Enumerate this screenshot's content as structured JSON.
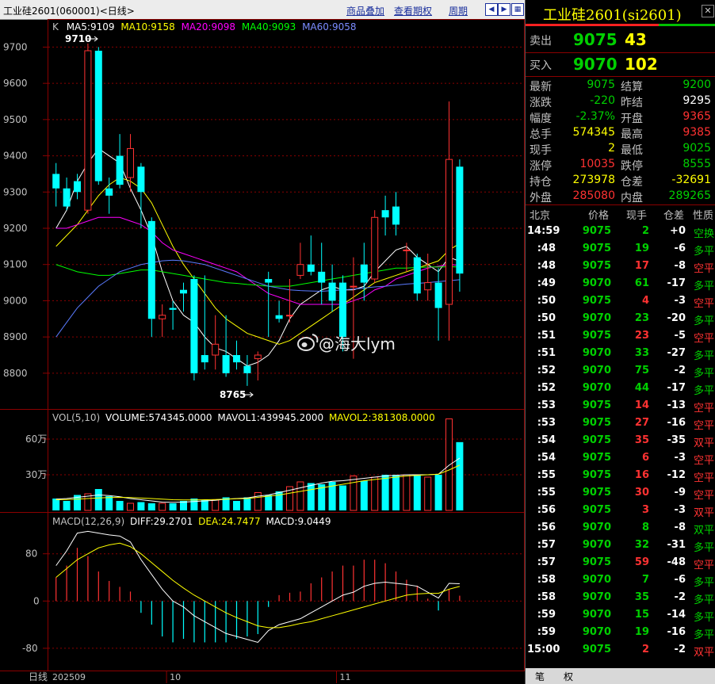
{
  "topbar": {
    "title": "工业硅2601(060001)<日线>",
    "links": [
      "商品叠加",
      "查看期权",
      "周期"
    ],
    "nav_icons": [
      "left-arrow-icon",
      "right-arrow-icon",
      "grid-icon"
    ]
  },
  "kline": {
    "indicator_label": "K",
    "ma": [
      {
        "label": "MA5:9109",
        "color": "#ffffff"
      },
      {
        "label": "MA10:9158",
        "color": "#ffff00"
      },
      {
        "label": "MA20:9098",
        "color": "#ff00ff"
      },
      {
        "label": "MA40:9093",
        "color": "#00ff00"
      },
      {
        "label": "MA60:9058",
        "color": "#5a7bff"
      }
    ],
    "high_label": "9710",
    "low_label": "8765",
    "y_ticks": [
      "9700",
      "9600",
      "9500",
      "9400",
      "9300",
      "9200",
      "9100",
      "9000",
      "8900",
      "8800"
    ],
    "ylim": [
      8710,
      9760
    ]
  },
  "volume_panel": {
    "legend": [
      {
        "label": "VOL(5,10)",
        "color": "#c0c0c0"
      },
      {
        "label": "VOLUME:574345.0000",
        "color": "#ffffff"
      },
      {
        "label": "MAVOL1:439945.2000",
        "color": "#ffffff"
      },
      {
        "label": "MAVOL2:381308.0000",
        "color": "#ffff00"
      }
    ],
    "y_ticks": [
      "60万",
      "30万"
    ],
    "ylim": [
      0,
      800000
    ]
  },
  "macd_panel": {
    "legend": [
      {
        "label": "MACD(12,26,9)",
        "color": "#c0c0c0"
      },
      {
        "label": "DIFF:29.2701",
        "color": "#ffffff"
      },
      {
        "label": "DEA:24.7477",
        "color": "#ffff00"
      },
      {
        "label": "MACD:9.0449",
        "color": "#ffffff"
      }
    ],
    "y_ticks": [
      "80",
      "0",
      "-80"
    ],
    "ylim": [
      -115,
      140
    ]
  },
  "x_axis": {
    "label": "日线",
    "ticks": [
      "202509",
      "10",
      "11"
    ]
  },
  "watermark": "@海大lym",
  "chart_data": {
    "type": "candlestick",
    "candles": [
      [
        9350,
        9380,
        9260,
        9310
      ],
      [
        9310,
        9340,
        9250,
        9260
      ],
      [
        9330,
        9350,
        9280,
        9300
      ],
      [
        9250,
        9710,
        9240,
        9690
      ],
      [
        9690,
        9700,
        9320,
        9330
      ],
      [
        9310,
        9340,
        9240,
        9290
      ],
      [
        9400,
        9460,
        9310,
        9320
      ],
      [
        9340,
        9460,
        9300,
        9420
      ],
      [
        9370,
        9380,
        9200,
        9300
      ],
      [
        9220,
        9230,
        8900,
        8950
      ],
      [
        8950,
        8990,
        8900,
        8960
      ],
      [
        8980,
        9000,
        8920,
        8975
      ],
      [
        9030,
        9050,
        8970,
        9020
      ],
      [
        9060,
        9070,
        8780,
        8800
      ],
      [
        8850,
        9070,
        8810,
        8830
      ],
      [
        8850,
        8960,
        8810,
        8880
      ],
      [
        8850,
        8960,
        8790,
        8800
      ],
      [
        8850,
        8890,
        8810,
        8830
      ],
      [
        8820,
        8850,
        8765,
        8800
      ],
      [
        8840,
        8860,
        8780,
        8850
      ],
      [
        9060,
        9080,
        8900,
        9050
      ],
      [
        8960,
        9000,
        8940,
        8950
      ],
      [
        8960,
        9060,
        8940,
        8960
      ],
      [
        9070,
        9160,
        9060,
        9100
      ],
      [
        9100,
        9180,
        9070,
        9080
      ],
      [
        9080,
        9160,
        8990,
        9050
      ],
      [
        9050,
        9100,
        8970,
        9000
      ],
      [
        9050,
        9070,
        8860,
        8900
      ],
      [
        9040,
        9120,
        8840,
        9040
      ],
      [
        9100,
        9160,
        9000,
        9050
      ],
      [
        9060,
        9250,
        9050,
        9230
      ],
      [
        9250,
        9290,
        9180,
        9230
      ],
      [
        9260,
        9300,
        9180,
        9210
      ],
      [
        9140,
        9160,
        9080,
        9140
      ],
      [
        9120,
        9130,
        9000,
        9020
      ],
      [
        9030,
        9130,
        9000,
        9050
      ],
      [
        9050,
        9090,
        8890,
        8980
      ],
      [
        8990,
        9550,
        8890,
        9390
      ],
      [
        9370,
        9390,
        9025,
        9075
      ]
    ],
    "ma5": [
      9200,
      9250,
      9330,
      9380,
      9420,
      9400,
      9380,
      9310,
      9250,
      9180,
      9080,
      9000,
      8960,
      8940,
      8900,
      8870,
      8860,
      8840,
      8820,
      8830,
      8850,
      8890,
      8950,
      8990,
      9010,
      9030,
      9040,
      9030,
      9030,
      9040,
      9080,
      9110,
      9140,
      9150,
      9120,
      9100,
      9080,
      9120,
      9109
    ],
    "ma10": [
      9150,
      9180,
      9210,
      9250,
      9290,
      9320,
      9340,
      9330,
      9310,
      9270,
      9210,
      9150,
      9100,
      9060,
      9020,
      8980,
      8950,
      8930,
      8910,
      8900,
      8890,
      8880,
      8890,
      8910,
      8930,
      8950,
      8970,
      8990,
      9010,
      9030,
      9050,
      9060,
      9070,
      9080,
      9090,
      9100,
      9110,
      9140,
      9158
    ],
    "ma20": [
      9200,
      9200,
      9210,
      9220,
      9230,
      9230,
      9230,
      9220,
      9210,
      9190,
      9160,
      9140,
      9130,
      9120,
      9110,
      9100,
      9090,
      9080,
      9060,
      9040,
      9020,
      9010,
      9000,
      8990,
      8990,
      8990,
      8990,
      8990,
      9000,
      9010,
      9030,
      9040,
      9060,
      9070,
      9080,
      9090,
      9095,
      9100,
      9098
    ],
    "ma40": [
      9100,
      9090,
      9080,
      9075,
      9070,
      9070,
      9075,
      9080,
      9085,
      9085,
      9080,
      9075,
      9070,
      9065,
      9060,
      9055,
      9050,
      9048,
      9045,
      9043,
      9040,
      9040,
      9040,
      9045,
      9050,
      9055,
      9060,
      9065,
      9070,
      9075,
      9080,
      9085,
      9090,
      9090,
      9092,
      9093,
      9093,
      9094,
      9093
    ],
    "ma60": [
      8900,
      8940,
      8980,
      9010,
      9040,
      9060,
      9080,
      9090,
      9100,
      9105,
      9110,
      9112,
      9110,
      9105,
      9100,
      9090,
      9080,
      9070,
      9060,
      9050,
      9040,
      9035,
      9030,
      9028,
      9027,
      9026,
      9028,
      9030,
      9032,
      9035,
      9038,
      9040,
      9043,
      9046,
      9048,
      9050,
      9053,
      9055,
      9058
    ],
    "volume": [
      100000,
      80000,
      130000,
      140000,
      180000,
      120000,
      80000,
      60000,
      70000,
      60000,
      60000,
      60000,
      80000,
      100000,
      90000,
      90000,
      110000,
      80000,
      110000,
      150000,
      130000,
      160000,
      200000,
      240000,
      230000,
      220000,
      240000,
      210000,
      290000,
      250000,
      280000,
      300000,
      300000,
      300000,
      300000,
      280000,
      300000,
      770000,
      574345
    ],
    "mavol1": [
      95000,
      100000,
      110000,
      120000,
      130000,
      125000,
      115000,
      100000,
      90000,
      80000,
      70000,
      68000,
      70000,
      75000,
      80000,
      85000,
      95000,
      100000,
      105000,
      120000,
      130000,
      150000,
      170000,
      190000,
      210000,
      230000,
      245000,
      250000,
      260000,
      270000,
      280000,
      290000,
      295000,
      300000,
      300000,
      300000,
      305000,
      380000,
      439945
    ],
    "mavol2": [
      90000,
      92000,
      95000,
      100000,
      105000,
      108000,
      110000,
      108000,
      104000,
      100000,
      95000,
      90000,
      88000,
      88000,
      90000,
      92000,
      95000,
      98000,
      100000,
      110000,
      120000,
      130000,
      145000,
      160000,
      175000,
      190000,
      205000,
      220000,
      235000,
      250000,
      260000,
      270000,
      280000,
      290000,
      295000,
      300000,
      305000,
      340000,
      381308
    ],
    "diff": [
      60,
      85,
      115,
      118,
      115,
      112,
      110,
      100,
      70,
      45,
      20,
      0,
      -10,
      -25,
      -35,
      -45,
      -55,
      -60,
      -65,
      -70,
      -50,
      -40,
      -35,
      -30,
      -20,
      -10,
      0,
      10,
      15,
      25,
      30,
      32,
      30,
      28,
      25,
      15,
      5,
      30,
      29.27
    ],
    "dea": [
      40,
      55,
      70,
      80,
      90,
      95,
      98,
      92,
      80,
      65,
      50,
      35,
      22,
      10,
      0,
      -10,
      -20,
      -28,
      -35,
      -42,
      -45,
      -45,
      -42,
      -38,
      -35,
      -30,
      -25,
      -20,
      -15,
      -10,
      -5,
      0,
      5,
      10,
      12,
      13,
      13,
      20,
      24.75
    ],
    "macd": [
      40,
      60,
      90,
      76,
      50,
      34,
      24,
      16,
      -20,
      -40,
      -60,
      -70,
      -64,
      -70,
      -70,
      -70,
      -70,
      -64,
      -60,
      -56,
      -10,
      10,
      14,
      16,
      30,
      40,
      50,
      60,
      60,
      70,
      70,
      64,
      50,
      36,
      26,
      4,
      -16,
      20,
      9.04
    ]
  },
  "right_panel": {
    "title": "工业硅2601(si2601)",
    "ask": {
      "label": "卖出",
      "price": "9075",
      "volume": "43"
    },
    "bid": {
      "label": "买入",
      "price": "9070",
      "volume": "102"
    },
    "quote": [
      [
        {
          "label": "最新",
          "value": "9075",
          "color": "#00d000"
        },
        {
          "label": "结算",
          "value": "9200",
          "color": "#00d000"
        }
      ],
      [
        {
          "label": "涨跌",
          "value": "-220",
          "color": "#00d000"
        },
        {
          "label": "昨结",
          "value": "9295",
          "color": "#ffffff"
        }
      ],
      [
        {
          "label": "幅度",
          "value": "-2.37%",
          "color": "#00d000"
        },
        {
          "label": "开盘",
          "value": "9365",
          "color": "#ff3232"
        }
      ],
      [
        {
          "label": "总手",
          "value": "574345",
          "color": "#ffff00"
        },
        {
          "label": "最高",
          "value": "9385",
          "color": "#ff3232"
        }
      ],
      [
        {
          "label": "现手",
          "value": "2",
          "color": "#ffff00"
        },
        {
          "label": "最低",
          "value": "9025",
          "color": "#00d000"
        }
      ],
      [
        {
          "label": "涨停",
          "value": "10035",
          "color": "#ff3232"
        },
        {
          "label": "跌停",
          "value": "8555",
          "color": "#00d000"
        }
      ],
      [
        {
          "label": "持仓",
          "value": "273978",
          "color": "#ffff00"
        },
        {
          "label": "仓差",
          "value": "-32691",
          "color": "#ffff00"
        }
      ],
      [
        {
          "label": "外盘",
          "value": "285080",
          "color": "#ff3232"
        },
        {
          "label": "内盘",
          "value": "289265",
          "color": "#00d000"
        }
      ]
    ],
    "ticks_header": [
      "北京",
      "价格",
      "现手",
      "仓差",
      "性质"
    ],
    "ticks": [
      {
        "time": "14:59",
        "price": "9075",
        "vol": "2",
        "oi": "+0",
        "nature": "空换",
        "vcolor": "#00d000",
        "ncolor": "#00d000"
      },
      {
        "time": ":48",
        "price": "9075",
        "vol": "19",
        "oi": "-6",
        "nature": "多平",
        "vcolor": "#00d000",
        "ncolor": "#00d000"
      },
      {
        "time": ":48",
        "price": "9075",
        "vol": "17",
        "oi": "-8",
        "nature": "空平",
        "vcolor": "#ff3232",
        "ncolor": "#ff3232"
      },
      {
        "time": ":49",
        "price": "9070",
        "vol": "61",
        "oi": "-17",
        "nature": "多平",
        "vcolor": "#00d000",
        "ncolor": "#00d000"
      },
      {
        "time": ":50",
        "price": "9075",
        "vol": "4",
        "oi": "-3",
        "nature": "空平",
        "vcolor": "#ff3232",
        "ncolor": "#ff3232"
      },
      {
        "time": ":50",
        "price": "9070",
        "vol": "23",
        "oi": "-20",
        "nature": "多平",
        "vcolor": "#00d000",
        "ncolor": "#00d000"
      },
      {
        "time": ":51",
        "price": "9075",
        "vol": "23",
        "oi": "-5",
        "nature": "空平",
        "vcolor": "#ff3232",
        "ncolor": "#ff3232"
      },
      {
        "time": ":51",
        "price": "9070",
        "vol": "33",
        "oi": "-27",
        "nature": "多平",
        "vcolor": "#00d000",
        "ncolor": "#00d000"
      },
      {
        "time": ":52",
        "price": "9070",
        "vol": "75",
        "oi": "-2",
        "nature": "多平",
        "vcolor": "#00d000",
        "ncolor": "#00d000"
      },
      {
        "time": ":52",
        "price": "9070",
        "vol": "44",
        "oi": "-17",
        "nature": "多平",
        "vcolor": "#00d000",
        "ncolor": "#00d000"
      },
      {
        "time": ":53",
        "price": "9075",
        "vol": "14",
        "oi": "-13",
        "nature": "空平",
        "vcolor": "#ff3232",
        "ncolor": "#ff3232"
      },
      {
        "time": ":53",
        "price": "9075",
        "vol": "27",
        "oi": "-16",
        "nature": "空平",
        "vcolor": "#ff3232",
        "ncolor": "#ff3232"
      },
      {
        "time": ":54",
        "price": "9075",
        "vol": "35",
        "oi": "-35",
        "nature": "双平",
        "vcolor": "#ff3232",
        "ncolor": "#ff3232"
      },
      {
        "time": ":54",
        "price": "9075",
        "vol": "6",
        "oi": "-3",
        "nature": "空平",
        "vcolor": "#ff3232",
        "ncolor": "#ff3232"
      },
      {
        "time": ":55",
        "price": "9075",
        "vol": "16",
        "oi": "-12",
        "nature": "空平",
        "vcolor": "#ff3232",
        "ncolor": "#ff3232"
      },
      {
        "time": ":55",
        "price": "9075",
        "vol": "30",
        "oi": "-9",
        "nature": "空平",
        "vcolor": "#ff3232",
        "ncolor": "#ff3232"
      },
      {
        "time": ":56",
        "price": "9075",
        "vol": "3",
        "oi": "-3",
        "nature": "双平",
        "vcolor": "#ff3232",
        "ncolor": "#ff3232"
      },
      {
        "time": ":56",
        "price": "9070",
        "vol": "8",
        "oi": "-8",
        "nature": "双平",
        "vcolor": "#00d000",
        "ncolor": "#00d000"
      },
      {
        "time": ":57",
        "price": "9070",
        "vol": "32",
        "oi": "-31",
        "nature": "多平",
        "vcolor": "#00d000",
        "ncolor": "#00d000"
      },
      {
        "time": ":57",
        "price": "9075",
        "vol": "59",
        "oi": "-48",
        "nature": "空平",
        "vcolor": "#ff3232",
        "ncolor": "#ff3232"
      },
      {
        "time": ":58",
        "price": "9070",
        "vol": "7",
        "oi": "-6",
        "nature": "多平",
        "vcolor": "#00d000",
        "ncolor": "#00d000"
      },
      {
        "time": ":58",
        "price": "9070",
        "vol": "35",
        "oi": "-2",
        "nature": "多平",
        "vcolor": "#00d000",
        "ncolor": "#00d000"
      },
      {
        "time": ":59",
        "price": "9070",
        "vol": "15",
        "oi": "-14",
        "nature": "多平",
        "vcolor": "#00d000",
        "ncolor": "#00d000"
      },
      {
        "time": ":59",
        "price": "9070",
        "vol": "19",
        "oi": "-16",
        "nature": "多平",
        "vcolor": "#00d000",
        "ncolor": "#00d000"
      },
      {
        "time": "15:00",
        "price": "9075",
        "vol": "2",
        "oi": "-2",
        "nature": "双平",
        "vcolor": "#ff3232",
        "ncolor": "#ff3232"
      }
    ],
    "bottom_tabs": [
      "笔",
      "权"
    ]
  }
}
